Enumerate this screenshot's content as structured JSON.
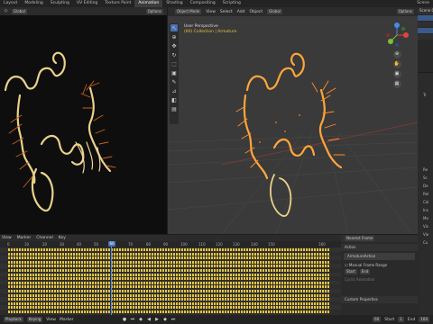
{
  "topbar": {
    "tabs": [
      "Layout",
      "Modeling",
      "Sculpting",
      "UV Editing",
      "Texture Paint",
      "Animation",
      "Shading",
      "Compositing",
      "Scripting"
    ],
    "active_tab": "Animation",
    "scene": "Scene"
  },
  "left_viewport": {
    "view_label": "Global",
    "options": "Options"
  },
  "right_viewport": {
    "mode": "Object Mode",
    "menus": [
      "View",
      "Select",
      "Add",
      "Object"
    ],
    "transform": "Global",
    "options": "Options",
    "perspective": "User Perspective",
    "collection": "(60) Collection | Armature"
  },
  "dope_sheet": {
    "menus": [
      "View",
      "Marker",
      "Channel",
      "Key"
    ],
    "frame_ticks": [
      "0",
      "10",
      "20",
      "30",
      "40",
      "50",
      "60",
      "70",
      "80",
      "90",
      "100",
      "110",
      "120",
      "130",
      "140",
      "150",
      "160"
    ],
    "current_frame": "60",
    "snap": "Nearest Frame",
    "action_panel": {
      "title": "Action",
      "action_name": "ArmatureAction",
      "manual_frame_range": "Manual Frame Range",
      "start_label": "Start",
      "end_label": "End",
      "cyclic": "Cyclic Animation",
      "custom_props": "Custom Properties"
    },
    "track_count": 16
  },
  "properties": {
    "items": [
      "Tr",
      "Re",
      "Sc",
      "De",
      "Rel",
      "Col",
      "Ins",
      "Mo",
      "Vis",
      "Vie",
      "Cu"
    ]
  },
  "outliner": {
    "title": "Scene Collection"
  },
  "timeline": {
    "playback": "Playback",
    "keying": "Keying",
    "view": "View",
    "marker": "Marker",
    "frame_current": "60",
    "start_label": "Start",
    "start": "1",
    "end_label": "End",
    "end": "160"
  },
  "colors": {
    "accent": "#4772b3",
    "keyframe": "#e7c542",
    "bone_dark": "#e9d189",
    "bone_selected": "#ffa63a"
  }
}
